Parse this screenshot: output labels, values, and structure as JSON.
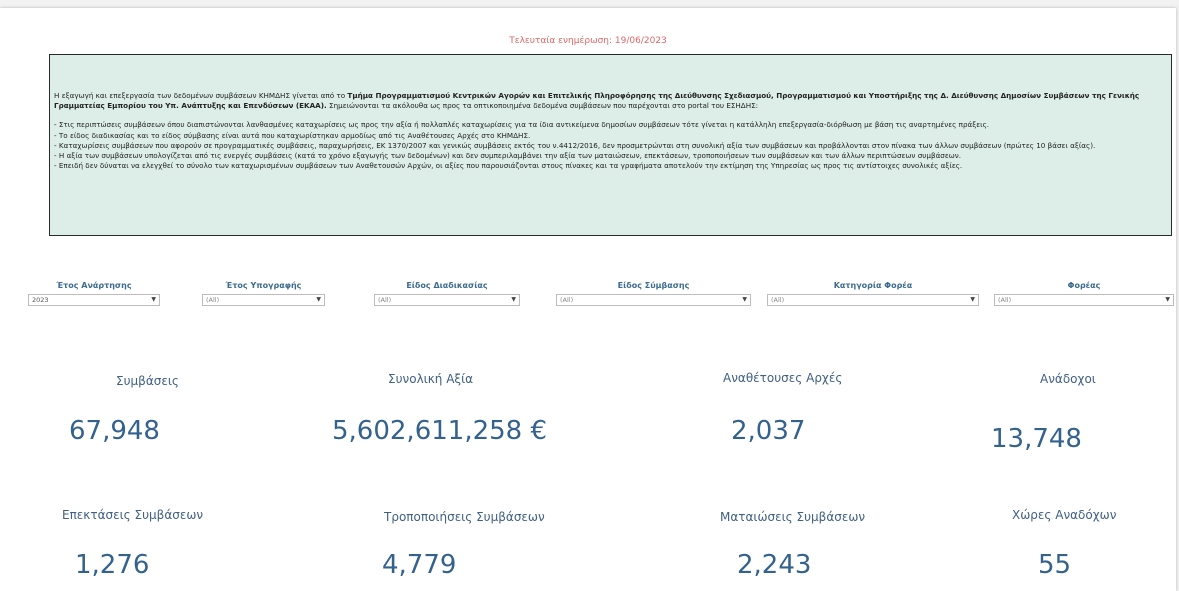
{
  "last_updated": "Τελευταία ενημέρωση: 19/06/2023",
  "notice": {
    "intro_plain_1": "Η εξαγωγή και επεξεργασία των δεδομένων συμβάσεων ΚΗΜΔΗΣ γίνεται από το ",
    "intro_bold": "Τμήμα Προγραμματισμού Κεντρικών Αγορών και Επιτελικής Πληροφόρησης της Διεύθυνσης Σχεδιασμού, Προγραμματισμού και Υποστήριξης της Δ. Διεύθυνσης Δημοσίων Συμβάσεων της Γενικής Γραμματείας Εμπορίου του Υπ. Ανάπτυξης και Επενδύσεων (ΕΚΑΑ).",
    "intro_plain_2": " Σημειώνονται τα ακόλουθα ως προς τα οπτικοποιημένα δεδομένα συμβάσεων που παρέχονται στο portal του ΕΣΗΔΗΣ:",
    "bullets": [
      "- Στις περιπτώσεις συμβάσεων όπου διαπιστώνονται λανθασμένες καταχωρίσεις ως προς την αξία ή πολλαπλές καταχωρίσεις για τα ίδια αντικείμενα δημοσίων συμβάσεων τότε γίνεται η κατάλληλη επεξεργασία-διόρθωση με βάση τις αναρτημένες πράξεις.",
      "- Το είδος διαδικασίας και το είδος σύμβασης είναι αυτά που καταχωρίστηκαν αρμοδίως από τις Αναθέτουσες Αρχές στο ΚΗΜΔΗΣ.",
      "- Καταχωρίσεις συμβάσεων που αφορούν σε προγραμματικές συμβάσεις, παραχωρήσεις, ΕΚ 1370/2007 και γενικώς συμβάσεις εκτός του ν.4412/2016, δεν προσμετρώνται στη συνολική αξία των συμβάσεων και προβάλλονται στον πίνακα των άλλων συμβάσεων (πρώτες 10 βάσει αξίας).",
      "- Η αξία των συμβάσεων υπολογίζεται από τις ενεργές συμβάσεις (κατά το χρόνο εξαγωγής των δεδομένων) και δεν συμπεριλαμβάνει την αξία των ματαιώσεων, επεκτάσεων, τροποποιήσεων των συμβάσεων και των άλλων περιπτώσεων συμβάσεων.",
      "- Επειδή δεν δύναται να ελεγχθεί το σύνολο των καταχωρισμένων συμβάσεων των Αναθετουσών Αρχών, οι αξίες που παρουσιάζονται στους πίνακες και τα γραφήματα αποτελούν την εκτίμηση της Υπηρεσίας ως προς τις αντίστοιχες συνολικές αξίες."
    ]
  },
  "filters": [
    {
      "label": "Έτος Ανάρτησης",
      "value": "2023"
    },
    {
      "label": "Έτος Υπογραφής",
      "value": "(All)"
    },
    {
      "label": "Είδος Διαδικασίας",
      "value": "(All)"
    },
    {
      "label": "Είδος Σύμβασης",
      "value": "(All)"
    },
    {
      "label": "Κατηγορία Φορέα",
      "value": "(All)"
    },
    {
      "label": "Φορέας",
      "value": "(All)"
    }
  ],
  "kpis": [
    {
      "label": "Συμβάσεις",
      "value": "67,948"
    },
    {
      "label": "Συνολική Αξία",
      "value": "5,602,611,258 €"
    },
    {
      "label": "Αναθέτουσες Αρχές",
      "value": "2,037"
    },
    {
      "label": "Ανάδοχοι",
      "value": "13,748"
    },
    {
      "label": "Επεκτάσεις Συμβάσεων",
      "value": "1,276"
    },
    {
      "label": "Τροποποιήσεις Συμβάσεων",
      "value": "4,779"
    },
    {
      "label": "Ματαιώσεις Συμβάσεων",
      "value": "2,243"
    },
    {
      "label": "Χώρες Αναδόχων",
      "value": "55"
    }
  ],
  "icons": {
    "dropdown": "chevron-down-icon"
  },
  "colors": {
    "notice_bg": "#dceee7",
    "kpi_text": "#34628e",
    "updated_text": "#e06666"
  }
}
